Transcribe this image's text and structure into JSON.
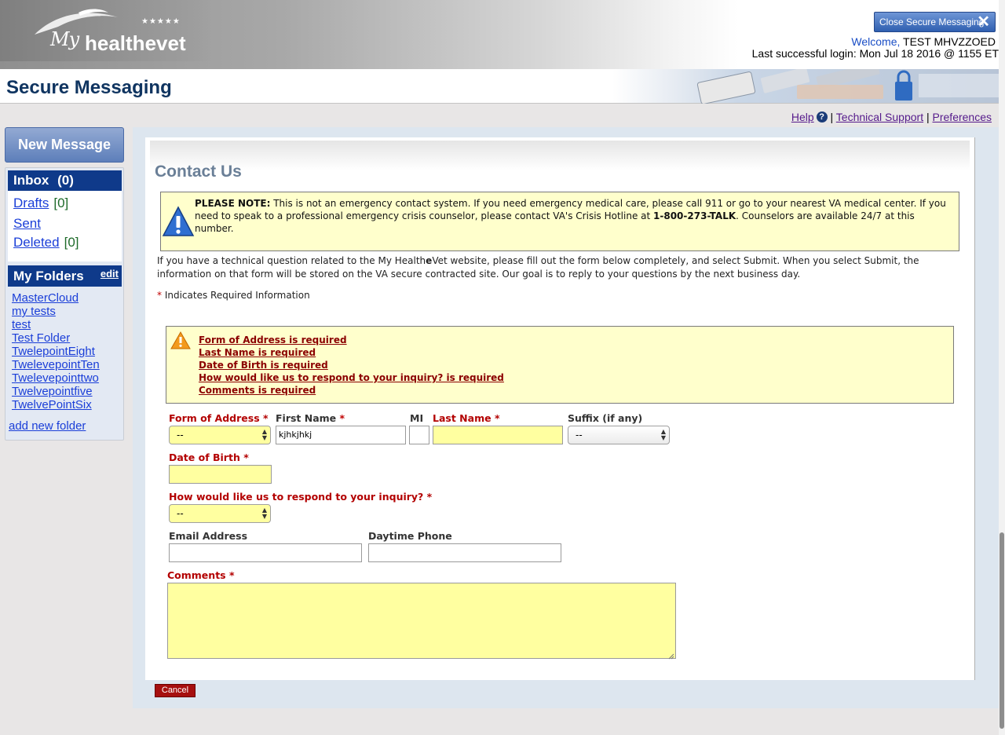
{
  "header": {
    "logo_my": "My",
    "logo_health": "healthevet",
    "close_button": "Close Secure Messaging",
    "welcome_label": "Welcome,",
    "welcome_user": "TEST MHVZZOED",
    "last_login": "Last successful login: Mon Jul 18 2016 @ 1155 ET"
  },
  "title": "Secure Messaging",
  "util_links": {
    "help": "Help",
    "help_icon": "?",
    "separator": "|",
    "technical_support": "Technical Support",
    "preferences": "Preferences"
  },
  "sidebar": {
    "new_message": "New Message",
    "inbox_label": "Inbox",
    "inbox_count": "(0)",
    "drafts_label": "Drafts",
    "drafts_count": "[0]",
    "sent_label": "Sent",
    "deleted_label": "Deleted",
    "deleted_count": "[0]",
    "folders_title": "My Folders",
    "folders_edit": "edit",
    "folders": [
      "MasterCloud",
      "my tests",
      "test",
      "Test Folder",
      "TwelepointEight",
      "TwelevepointTen",
      "Twelevepointtwo",
      "Twelvepointfive",
      "TwelvePointSix"
    ],
    "add_folder": "add new folder"
  },
  "main": {
    "title": "Contact Us",
    "note_label": "PLEASE NOTE:",
    "note_text_1": "This is not an emergency contact system. If you need emergency medical care, please call 911 or go to your nearest VA medical center. If you need to speak to a professional emergency crisis counselor, please contact VA's Crisis Hotline at",
    "note_phone": "1-800-273-TALK",
    "note_text_2": ". Counselors are available 24/7 at this number.",
    "intro_1": "If you have a technical question related to the My Health",
    "intro_e": "e",
    "intro_2": "Vet website, please fill out the form below completely, and select Submit. When you select Submit, the information on that form will be stored on the VA secure contracted site. Our goal is to reply to your questions by the next business day.",
    "required_star": "*",
    "required_note": "Indicates Required Information",
    "errors": [
      "Form of Address is required",
      "Last Name is required",
      "Date of Birth is required",
      "How would like us to respond to your inquiry? is required",
      "Comments is required"
    ],
    "form": {
      "form_of_address_label": "Form of Address",
      "form_of_address_value": "--",
      "first_name_label": "First Name",
      "first_name_value": "kjhkjhkj",
      "mi_label": "MI",
      "mi_value": "",
      "last_name_label": "Last Name",
      "last_name_value": "",
      "suffix_label": "Suffix (if any)",
      "suffix_value": "--",
      "dob_label": "Date of Birth",
      "dob_value": "",
      "respond_label": "How would like us to respond to your inquiry?",
      "respond_value": "--",
      "email_label": "Email Address",
      "email_value": "",
      "phone_label": "Daytime Phone",
      "phone_value": "",
      "comments_label": "Comments",
      "comments_value": "",
      "star": "*"
    },
    "cancel": "Cancel"
  },
  "colors": {
    "navy": "#0f3a8a",
    "title_blue": "#0f3460",
    "error_red": "#8b0000",
    "required_red": "#b30000",
    "highlight_yellow": "#ffffa0",
    "note_yellow": "#ffffcc"
  }
}
